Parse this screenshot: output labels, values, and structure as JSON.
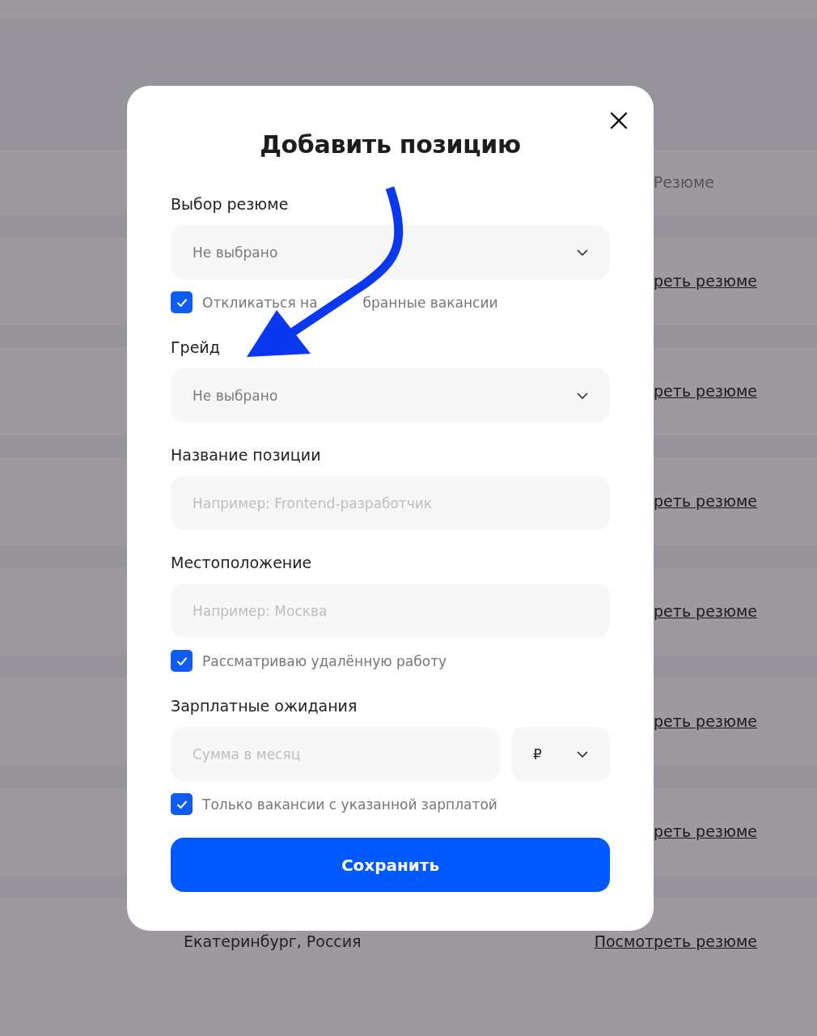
{
  "background": {
    "header": "Резюме",
    "rows": [
      {
        "link": "реть резюме"
      },
      {
        "link": "реть резюме"
      },
      {
        "link": "реть резюме"
      },
      {
        "link": "реть резюме"
      },
      {
        "link": "реть резюме"
      },
      {
        "link": "реть резюме"
      },
      {
        "city": "Екатеринбург, Россия",
        "link": "Посмотреть резюме"
      }
    ]
  },
  "dialog": {
    "title": "Добавить позицию",
    "rows": [
      {
        "kind": "select",
        "label": "Выбор резюме",
        "value": "Не выбрано"
      },
      {
        "kind": "checkbox",
        "label": "Откликаться на",
        "label_tail": "бранные вакансии",
        "checked": true
      },
      {
        "kind": "select",
        "label": "Грейд",
        "value": "Не выбрано"
      },
      {
        "kind": "text",
        "label": "Название позиции",
        "placeholder": "Например: Frontend-разработчик"
      },
      {
        "kind": "text",
        "label": "Местоположение",
        "placeholder": "Например: Москва"
      },
      {
        "kind": "checkbox",
        "label": "Рассматриваю удалённую работу",
        "checked": true
      },
      {
        "kind": "money",
        "label": "Зарплатные ожидания",
        "placeholder": "Сумма в месяц",
        "currency": "₽"
      },
      {
        "kind": "checkbox",
        "label": "Только вакансии с указанной зарплатой",
        "checked": true
      }
    ],
    "button": "Сохранить"
  }
}
